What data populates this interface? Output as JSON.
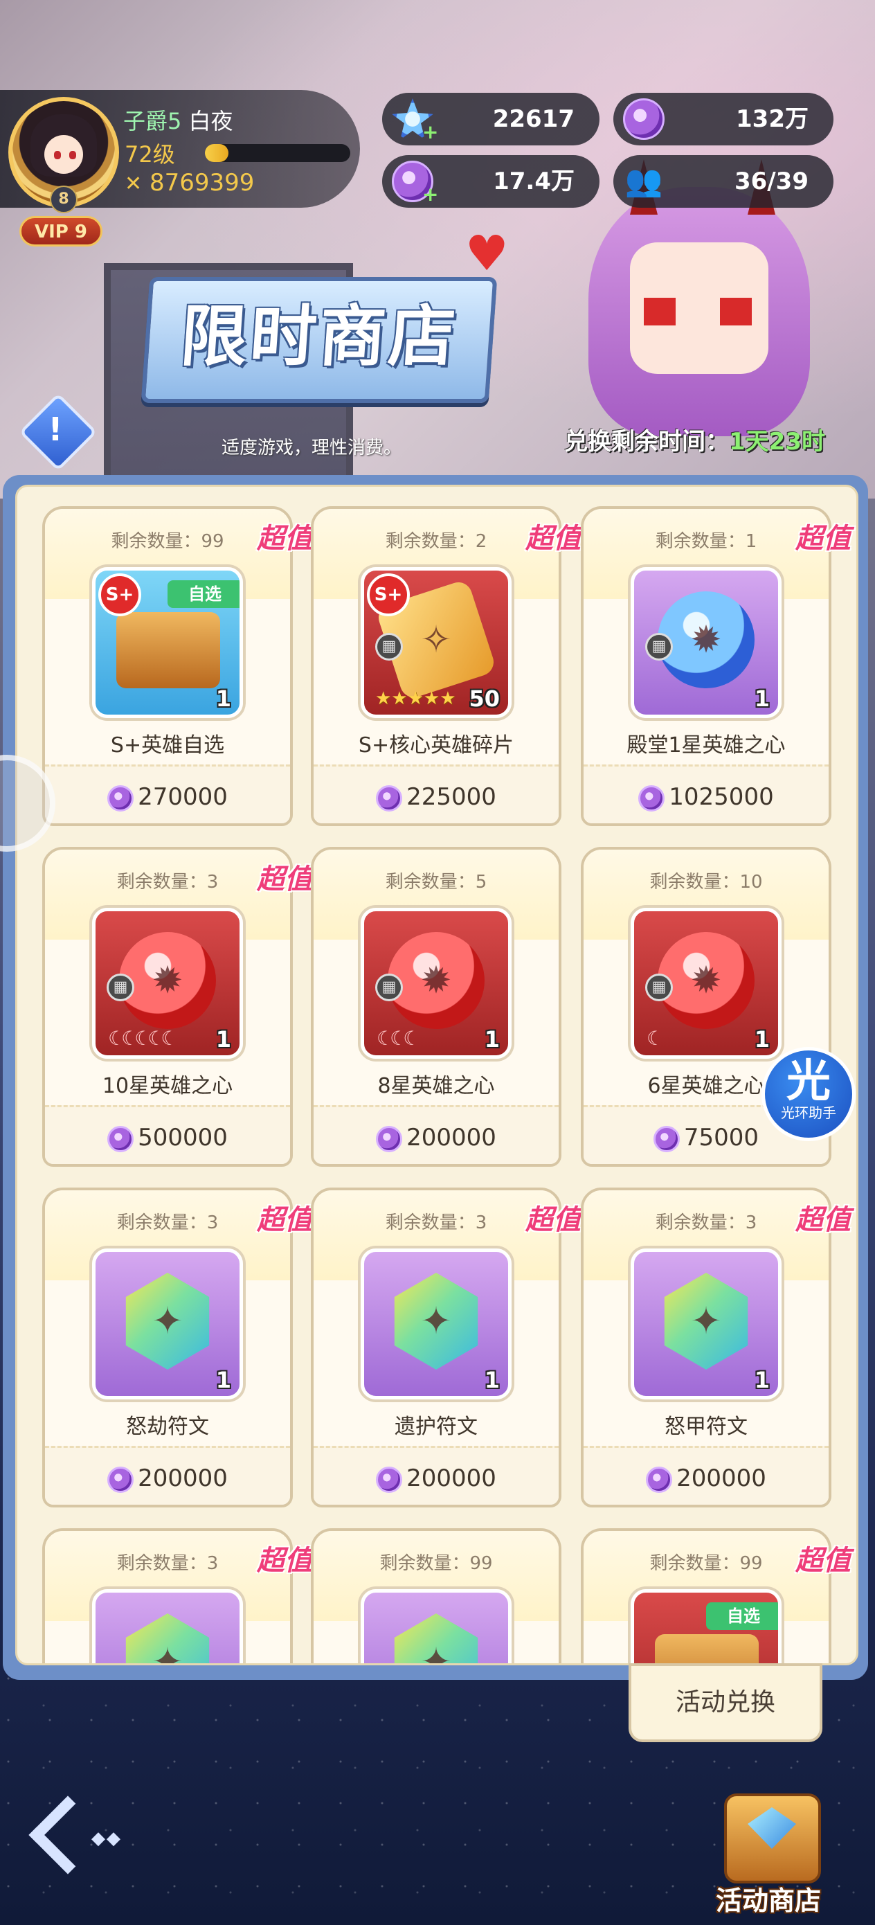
{
  "player": {
    "rank": "子爵5",
    "name": "白夜",
    "level": "72级",
    "level_progress": 0.16,
    "power": "8769399",
    "avatar_level": "8",
    "vip": "VIP 9"
  },
  "resources": {
    "stars": "22617",
    "coins_top": "132万",
    "coins_bottom": "17.4万",
    "members": "36/39"
  },
  "shop": {
    "title": "限时商店",
    "advice": "适度游戏，理性消费。",
    "timer_label": "兑换剩余时间：",
    "timer_value": "1天23时"
  },
  "items": [
    {
      "remain": "剩余数量：99",
      "tag": "超值",
      "name": "S+英雄自选",
      "price": "270000",
      "count": "1",
      "bg": "blue",
      "art": "chest",
      "s_badge": "S+",
      "select_badge": "自选"
    },
    {
      "remain": "剩余数量：2",
      "tag": "超值",
      "name": "S+核心英雄碎片",
      "price": "225000",
      "count": "50",
      "bg": "red",
      "art": "shard",
      "s_badge": "S+",
      "stars": "★★★★★"
    },
    {
      "remain": "剩余数量：1",
      "tag": "超值",
      "name": "殿堂1星英雄之心",
      "price": "1025000",
      "count": "1",
      "bg": "purple",
      "art": "orb-blue"
    },
    {
      "remain": "剩余数量：3",
      "tag": "超值",
      "name": "10星英雄之心",
      "price": "500000",
      "count": "1",
      "bg": "red",
      "art": "orb-red",
      "moons": "☾☾☾☾☾"
    },
    {
      "remain": "剩余数量：5",
      "tag": "",
      "name": "8星英雄之心",
      "price": "200000",
      "count": "1",
      "bg": "red",
      "art": "orb-red",
      "moons": "☾☾☾"
    },
    {
      "remain": "剩余数量：10",
      "tag": "",
      "name": "6星英雄之心",
      "price": "75000",
      "count": "1",
      "bg": "red",
      "art": "orb-red",
      "moons": "☾"
    },
    {
      "remain": "剩余数量：3",
      "tag": "超值",
      "name": "怒劫符文",
      "price": "200000",
      "count": "1",
      "bg": "purple",
      "art": "rune"
    },
    {
      "remain": "剩余数量：3",
      "tag": "超值",
      "name": "遗护符文",
      "price": "200000",
      "count": "1",
      "bg": "purple",
      "art": "rune"
    },
    {
      "remain": "剩余数量：3",
      "tag": "超值",
      "name": "怒甲符文",
      "price": "200000",
      "count": "1",
      "bg": "purple",
      "art": "rune"
    },
    {
      "remain": "剩余数量：3",
      "tag": "超值",
      "name": "",
      "price": "",
      "count": "",
      "bg": "purple",
      "art": "rune"
    },
    {
      "remain": "剩余数量：99",
      "tag": "",
      "name": "",
      "price": "",
      "count": "",
      "bg": "purple",
      "art": "rune"
    },
    {
      "remain": "剩余数量：99",
      "tag": "超值",
      "name": "",
      "price": "",
      "count": "",
      "bg": "red",
      "art": "chest",
      "select_badge": "自选"
    }
  ],
  "helper": {
    "char": "光",
    "label": "光环助手"
  },
  "buttons": {
    "exchange": "活动兑换",
    "activity_shop": "活动商店",
    "back_dots": "◆◆"
  },
  "colors": {
    "accent_pink": "#ef3d7a",
    "timer_green": "#8df073",
    "panel_blue": "#6d8fc8"
  }
}
